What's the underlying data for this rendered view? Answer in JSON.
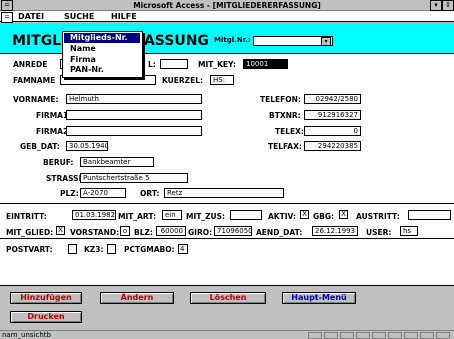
{
  "window": {
    "title": "Microsoft Access - [MITGLIEDERERFASSUNG]",
    "control_menu": "=",
    "min_glyph": "▾",
    "restore_glyph": "⇕"
  },
  "menubar": {
    "control_menu": "=",
    "items": [
      {
        "label": "DATEI"
      },
      {
        "label": "SUCHE"
      },
      {
        "label": "HILFE"
      }
    ]
  },
  "dropdown": {
    "items": [
      {
        "label": "Mitglieds-Nr.",
        "selected": true
      },
      {
        "label": "Name",
        "selected": false
      },
      {
        "label": "Firma",
        "selected": false
      },
      {
        "label": "PAN-Nr.",
        "selected": false
      }
    ]
  },
  "header": {
    "title_left": "MITGL",
    "title_right": "FASSUNG",
    "mitgl_nr_label": "Mitgl.Nr.:",
    "mitgl_nr_value": "",
    "mitgl_nr_arrow": "▾"
  },
  "fields": {
    "anrede": {
      "label": "ANREDE",
      "value": ""
    },
    "titel": {
      "label": "L:",
      "value": ""
    },
    "mit_key": {
      "label": "MIT_KEY:",
      "value": "10001"
    },
    "famname": {
      "label": "FAMNAME",
      "value": ""
    },
    "kuerzel": {
      "label": "KUERZEL:",
      "value": "HS:"
    },
    "vorname": {
      "label": "VORNAME:",
      "value": "Helmuth"
    },
    "telefon": {
      "label": "TELEFON:",
      "value": "02942/2580"
    },
    "firma1": {
      "label": "FIRMA1:",
      "value": ""
    },
    "btxnr": {
      "label": "BTXNR:",
      "value": "912916327"
    },
    "firma2": {
      "label": "FIRMA2:",
      "value": ""
    },
    "telex": {
      "label": "TELEX:",
      "value": "0"
    },
    "geb_dat": {
      "label": "GEB_DAT:",
      "value": "30.05.1940"
    },
    "telfax": {
      "label": "TELFAX:",
      "value": "294220385"
    },
    "beruf": {
      "label": "BERUF:",
      "value": "Bankbeamter"
    },
    "strasse": {
      "label": "STRASSE:",
      "value": "Puntschertstraße 5"
    },
    "plz": {
      "label": "PLZ:",
      "value": "A-2070"
    },
    "ort": {
      "label": "ORT:",
      "value": "Retz"
    }
  },
  "membership": {
    "eintritt": {
      "label": "EINTRITT:",
      "value": "01.03.1982"
    },
    "mit_art": {
      "label": "MIT_ART:",
      "value": "ein"
    },
    "mit_zus": {
      "label": "MIT_ZUS:",
      "value": ""
    },
    "aktiv": {
      "label": "AKTIV:",
      "checked": "X"
    },
    "gbg": {
      "label": "GBG:",
      "checked": "X"
    },
    "austritt": {
      "label": "AUSTRITT:",
      "value": ""
    },
    "mit_glied": {
      "label": "MIT_GLIED:",
      "checked": "X"
    },
    "vorstand": {
      "label": "VORSTAND:",
      "value": "o"
    },
    "blz": {
      "label": "BLZ:",
      "value": "60000"
    },
    "giro": {
      "label": "GIRO:",
      "value": "71096050"
    },
    "aend_dat": {
      "label": "AEND_DAT:",
      "value": "26.12.1993"
    },
    "user": {
      "label": "USER:",
      "value": "hs"
    }
  },
  "postal": {
    "postvart": {
      "label": "POSTVART:",
      "checked": ""
    },
    "kz3": {
      "label": "KZ3:",
      "checked": ""
    },
    "pctgmabo": {
      "label": "PCTGMABO:",
      "value": "4"
    }
  },
  "buttons": {
    "hinzufuegen": "Hinzufügen",
    "aendern": "Ändern",
    "loeschen": "Löschen",
    "hauptmenu": "Haupt-Menü",
    "drucken": "Drucken"
  },
  "status": {
    "text": "nam_unsichtb"
  }
}
